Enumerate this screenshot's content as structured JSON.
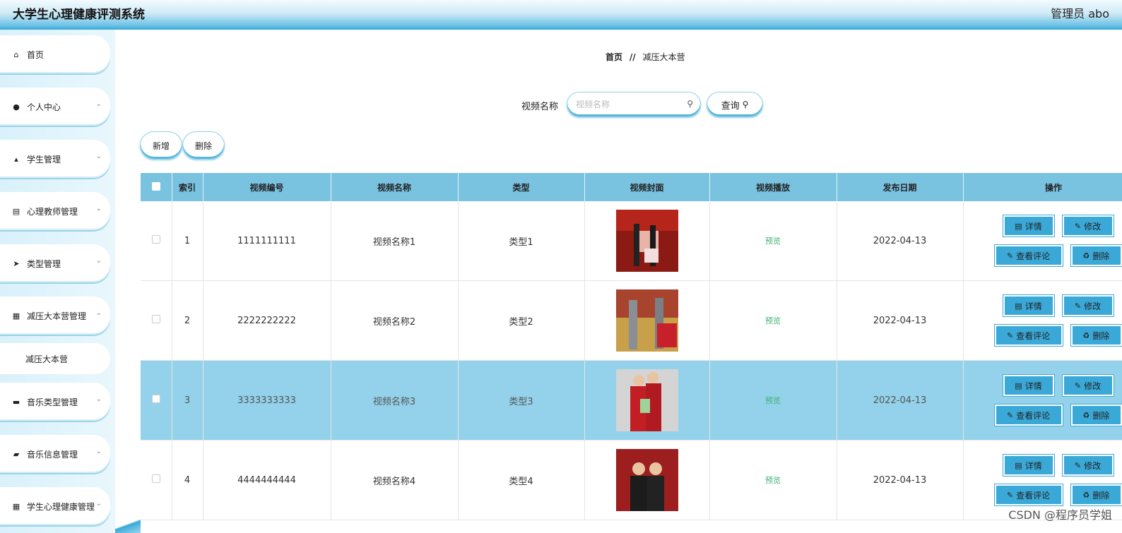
{
  "header": {
    "title": "大学生心理健康评测系统",
    "user": "管理员 abo"
  },
  "sidebar": {
    "items": [
      {
        "label": "首页",
        "icon": "⌂",
        "icon_name": "home-icon",
        "has_children": false
      },
      {
        "label": "个人中心",
        "icon": "●",
        "icon_name": "user-icon",
        "has_children": true
      },
      {
        "label": "学生管理",
        "icon": "▴",
        "icon_name": "student-icon",
        "has_children": true
      },
      {
        "label": "心理教师管理",
        "icon": "▤",
        "icon_name": "clipboard-icon",
        "has_children": true
      },
      {
        "label": "类型管理",
        "icon": "➤",
        "icon_name": "send-icon",
        "has_children": true
      },
      {
        "label": "减压大本营管理",
        "icon": "▦",
        "icon_name": "grid-icon",
        "has_children": true
      },
      {
        "label": "音乐类型管理",
        "icon": "▬",
        "icon_name": "briefcase-icon",
        "has_children": true
      },
      {
        "label": "音乐信息管理",
        "icon": "▰",
        "icon_name": "ticket-icon",
        "has_children": true
      },
      {
        "label": "学生心理健康管理",
        "icon": "▦",
        "icon_name": "grid-icon",
        "has_children": true
      }
    ],
    "submenu": {
      "label": "减压大本营"
    },
    "chevron": "⌄"
  },
  "breadcrumb": {
    "home": "首页",
    "separator": "//",
    "current": "减压大本营"
  },
  "search": {
    "label": "视频名称",
    "placeholder": "视频名称",
    "value": "",
    "button": "查询"
  },
  "actions": {
    "add": "新增",
    "delete": "删除"
  },
  "table": {
    "columns": [
      "索引",
      "视频编号",
      "视频名称",
      "类型",
      "视频封面",
      "视频播放",
      "发布日期",
      "操作"
    ],
    "rows": [
      {
        "index": "1",
        "code": "1111111111",
        "name": "视频名称1",
        "type": "类型1",
        "play": "预览",
        "date": "2022-04-13",
        "highlight": false
      },
      {
        "index": "2",
        "code": "2222222222",
        "name": "视频名称2",
        "type": "类型2",
        "play": "预览",
        "date": "2022-04-13",
        "highlight": false
      },
      {
        "index": "3",
        "code": "3333333333",
        "name": "视频名称3",
        "type": "类型3",
        "play": "预览",
        "date": "2022-04-13",
        "highlight": true
      },
      {
        "index": "4",
        "code": "4444444444",
        "name": "视频名称4",
        "type": "类型4",
        "play": "预览",
        "date": "2022-04-13",
        "highlight": false
      }
    ],
    "row_buttons": {
      "detail": "详情",
      "edit": "修改",
      "comments": "查看评论",
      "remove": "删除"
    }
  },
  "colors": {
    "accent": "#3aa9d8",
    "header_row": "#79c2e0",
    "highlight_row": "#93d2ea",
    "preview_link": "#3cb371"
  },
  "watermark": "CSDN @程序员学姐"
}
